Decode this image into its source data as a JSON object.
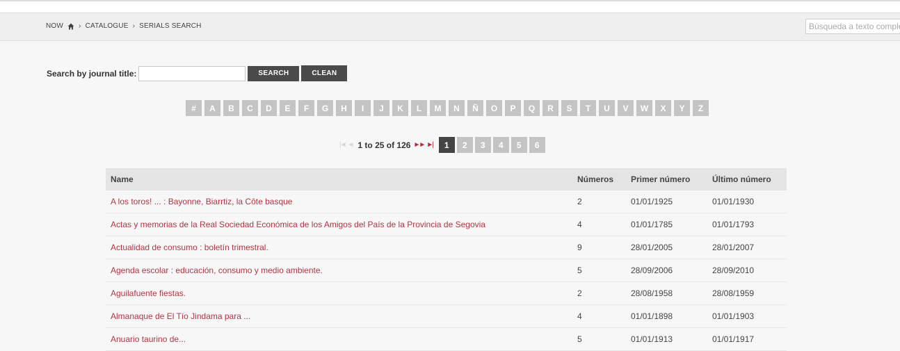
{
  "breadcrumb": {
    "now": "NOW",
    "sep": "›",
    "catalogue": "CATALOGUE",
    "serials": "SERIALS SEARCH"
  },
  "fulltext": {
    "placeholder": "Búsqueda a texto completo"
  },
  "search": {
    "label": "Search by journal title:",
    "value": "",
    "search_button": "SEARCH",
    "clean_button": "CLEAN"
  },
  "alphabet": [
    "#",
    "A",
    "B",
    "C",
    "D",
    "E",
    "F",
    "G",
    "H",
    "I",
    "J",
    "K",
    "L",
    "M",
    "N",
    "Ñ",
    "O",
    "P",
    "Q",
    "R",
    "S",
    "T",
    "U",
    "V",
    "W",
    "X",
    "Y",
    "Z"
  ],
  "pagination": {
    "first_arrow": "|◄",
    "prev_arrow": "◄",
    "range_text": "1 to 25 of 126",
    "next_arrow": "►►",
    "last_arrow": "►|",
    "pages": [
      "1",
      "2",
      "3",
      "4",
      "5",
      "6"
    ],
    "current_page": "1"
  },
  "table": {
    "headers": {
      "name": "Name",
      "numeros": "Números",
      "primer": "Primer número",
      "ultimo": "Último número"
    },
    "rows": [
      {
        "name": "A los toros! ... : Bayonne, Biarrtiz, la Côte basque",
        "numeros": "2",
        "primer": "01/01/1925",
        "ultimo": "01/01/1930"
      },
      {
        "name": "Actas y memorias de la Real Sociedad Económica de los Amigos del País de la Provincia de Segovia",
        "numeros": "4",
        "primer": "01/01/1785",
        "ultimo": "01/01/1793"
      },
      {
        "name": "Actualidad de consumo : boletín trimestral.",
        "numeros": "9",
        "primer": "28/01/2005",
        "ultimo": "28/01/2007"
      },
      {
        "name": "Agenda escolar : educación, consumo y medio ambiente.",
        "numeros": "5",
        "primer": "28/09/2006",
        "ultimo": "28/09/2010"
      },
      {
        "name": "Aguilafuente fiestas.",
        "numeros": "2",
        "primer": "28/08/1958",
        "ultimo": "28/08/1959"
      },
      {
        "name": "Almanaque de El Tío Jindama para ...",
        "numeros": "4",
        "primer": "01/01/1898",
        "ultimo": "01/01/1903"
      },
      {
        "name": "Anuario taurino de...",
        "numeros": "5",
        "primer": "01/01/1913",
        "ultimo": "01/01/1917"
      }
    ]
  },
  "colors": {
    "link": "#b03545",
    "accent_dark": "#4a4a4a",
    "letter_bg": "#c4c4c4",
    "nav_active": "#b52b3a"
  },
  "icons": {
    "home": "home-icon"
  }
}
